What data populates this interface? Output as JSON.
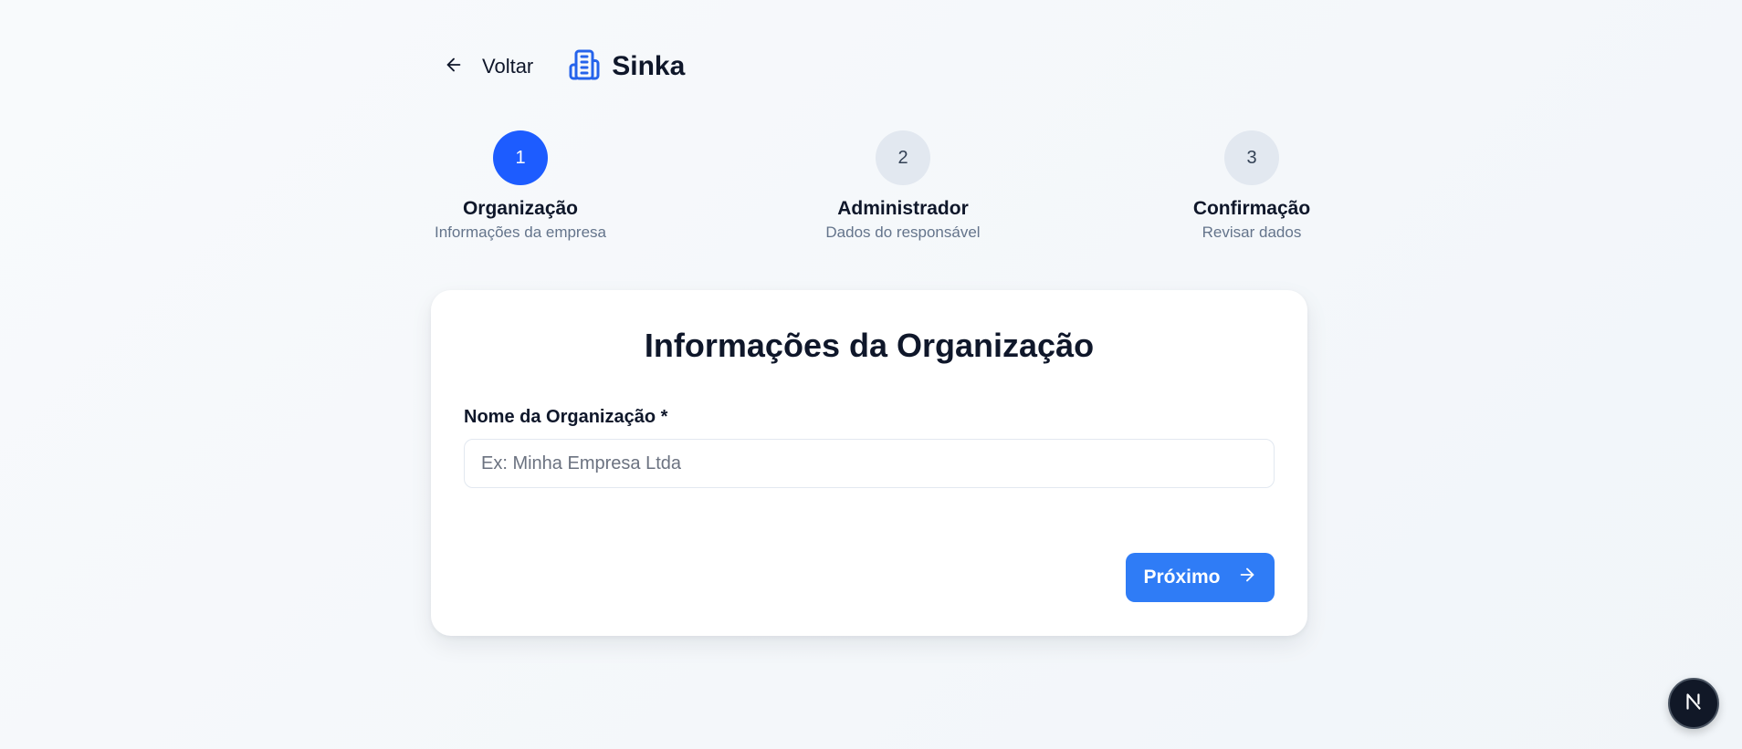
{
  "header": {
    "back_label": "Voltar",
    "brand_name": "Sinka",
    "back_icon": "arrow-left-icon",
    "brand_icon": "building-icon"
  },
  "stepper": {
    "steps": [
      {
        "number": "1",
        "title": "Organização",
        "subtitle": "Informações da empresa",
        "active": true
      },
      {
        "number": "2",
        "title": "Administrador",
        "subtitle": "Dados do responsável",
        "active": false
      },
      {
        "number": "3",
        "title": "Confirmação",
        "subtitle": "Revisar dados",
        "active": false
      }
    ]
  },
  "form": {
    "title": "Informações da Organização",
    "org_name_label": "Nome da Organização *",
    "org_name_value": "",
    "org_name_placeholder": "Ex: Minha Empresa Ltda",
    "next_label": "Próximo",
    "next_icon": "arrow-right-icon"
  },
  "dev_badge": {
    "icon": "nextjs-logo-icon"
  },
  "colors": {
    "primary": "#1d5cff",
    "button": "#2f7cf6",
    "brand_icon": "#2563eb",
    "inactive_step": "#e2e8f0",
    "muted_text": "#64748b"
  }
}
